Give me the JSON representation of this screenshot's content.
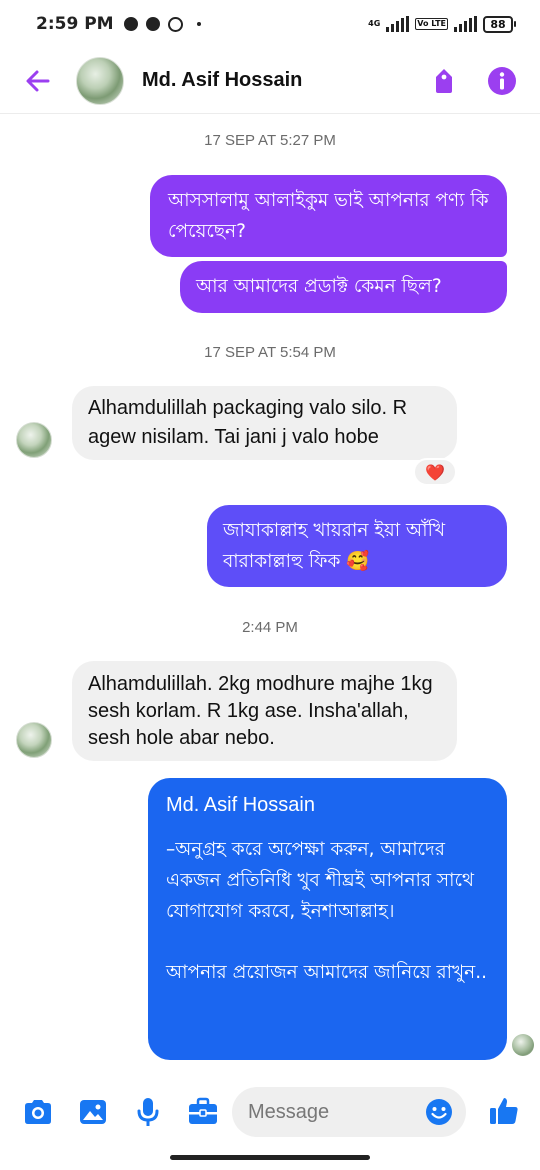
{
  "status_bar": {
    "time": "2:59 PM",
    "network": "4G",
    "volte": "Vo LTE",
    "battery": "88"
  },
  "header": {
    "contact_name": "Md. Asif Hossain",
    "back_icon": "arrow-left-icon",
    "actions": [
      "tag-icon",
      "info-icon"
    ]
  },
  "colors": {
    "accent_purple": "#9b3ff0",
    "bubble_purple": "#8a3cf5",
    "bubble_indigo": "#5e4ef8",
    "bubble_blue": "#1b66f0",
    "incoming_bubble": "#f0f0f0",
    "composer_icon": "#1877f2"
  },
  "chat": {
    "timestamp_1": "17 SEP AT 5:27 PM",
    "msg_1": "আসসালামু আলাইকুম ভাই আপনার পণ্য কি পেয়েছেন?",
    "msg_2": "আর আমাদের প্রডাক্ট কেমন ছিল?",
    "timestamp_2": "17 SEP AT 5:54 PM",
    "msg_3": "Alhamdulillah packaging  valo silo. R agew nisilam. Tai jani j valo hobe",
    "msg_3_reaction": "❤️",
    "msg_4": "জাযাকাল্লাহ খায়রান ইয়া আঁখি বারাকাল্লাহু ফিক 🥰",
    "timestamp_3": "2:44 PM",
    "msg_5": "Alhamdulillah. 2kg modhure majhe 1kg sesh korlam. R 1kg ase. Insha'allah, sesh hole abar nebo.",
    "msg_6": {
      "name": "Md. Asif Hossain",
      "body": "–অনুগ্রহ করে অপেক্ষা করুন, আমাদের একজন প্রতিনিধি খুব শীঘ্রই আপনার সাথে যোগাযোগ করবে, ইনশাআল্লাহ।",
      "footer": "আপনার প্রয়োজন আমাদের জানিয়ে রাখুন.."
    }
  },
  "composer": {
    "placeholder": "Message",
    "icons": [
      "camera-icon",
      "image-icon",
      "microphone-icon",
      "briefcase-icon",
      "emoji-icon",
      "thumbs-up-icon"
    ]
  }
}
